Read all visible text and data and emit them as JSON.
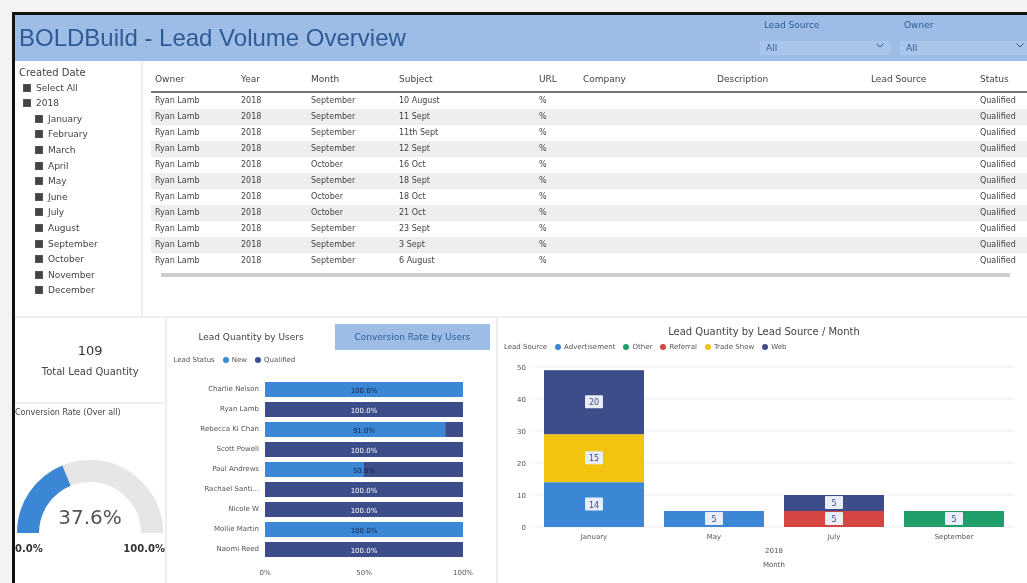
{
  "header": {
    "title": "BOLDBuild - Lead Volume Overview",
    "filters": [
      {
        "label": "Lead Source",
        "value": "All"
      },
      {
        "label": "Owner",
        "value": "All"
      }
    ]
  },
  "date_slicer": {
    "title": "Created Date",
    "items": [
      {
        "label": "Select All",
        "checked": true
      },
      {
        "label": "2018",
        "checked": true,
        "children": [
          {
            "label": "January",
            "checked": true
          },
          {
            "label": "February",
            "checked": true
          },
          {
            "label": "March",
            "checked": true
          },
          {
            "label": "April",
            "checked": true
          },
          {
            "label": "May",
            "checked": true
          },
          {
            "label": "June",
            "checked": true
          },
          {
            "label": "July",
            "checked": true
          },
          {
            "label": "August",
            "checked": true
          },
          {
            "label": "September",
            "checked": true
          },
          {
            "label": "October",
            "checked": true
          },
          {
            "label": "November",
            "checked": true
          },
          {
            "label": "December",
            "checked": true
          }
        ]
      }
    ]
  },
  "table": {
    "columns": [
      "Owner",
      "Year",
      "Month",
      "Subject",
      "URL",
      "Company",
      "Description",
      "Lead Source",
      "Status"
    ],
    "rows": [
      [
        "Ryan Lamb",
        "2018",
        "September",
        "10 August",
        "%",
        "",
        "",
        "",
        "Qualified"
      ],
      [
        "Ryan Lamb",
        "2018",
        "September",
        "11 Sept",
        "%",
        "",
        "",
        "",
        "Qualified"
      ],
      [
        "Ryan Lamb",
        "2018",
        "September",
        "11th Sept",
        "%",
        "",
        "",
        "",
        "Qualified"
      ],
      [
        "Ryan Lamb",
        "2018",
        "September",
        "12 Sept",
        "%",
        "",
        "",
        "",
        "Qualified"
      ],
      [
        "Ryan Lamb",
        "2018",
        "October",
        "16 Oct",
        "%",
        "",
        "",
        "",
        "Qualified"
      ],
      [
        "Ryan Lamb",
        "2018",
        "September",
        "18 Sept",
        "%",
        "",
        "",
        "",
        "Qualified"
      ],
      [
        "Ryan Lamb",
        "2018",
        "October",
        "18 Oct",
        "%",
        "",
        "",
        "",
        "Qualified"
      ],
      [
        "Ryan Lamb",
        "2018",
        "October",
        "21 Oct",
        "%",
        "",
        "",
        "",
        "Qualified"
      ],
      [
        "Ryan Lamb",
        "2018",
        "September",
        "23 Sept",
        "%",
        "",
        "",
        "",
        "Qualified"
      ],
      [
        "Ryan Lamb",
        "2018",
        "September",
        "3 Sept",
        "%",
        "",
        "",
        "",
        "Qualified"
      ],
      [
        "Ryan Lamb",
        "2018",
        "September",
        "6 August",
        "%",
        "",
        "",
        "",
        "Qualified"
      ]
    ]
  },
  "card": {
    "value": "109",
    "label": "Total Lead Quantity"
  },
  "gauge": {
    "title": "Conversion Rate (Over all)",
    "reading": "37.6%",
    "min": "0.0%",
    "max": "100.0%"
  },
  "tabs": [
    {
      "label": "Lead Quantity by Users",
      "selected": false
    },
    {
      "label": "Conversion Rate by Users",
      "selected": true
    }
  ],
  "users_chart": {
    "chart_data": {
      "type": "bar",
      "orientation": "horizontal",
      "stacked": true,
      "legend_title": "Lead Status",
      "xlim": [
        0,
        1
      ],
      "categories": [
        "Charlie Nelson",
        "Ryan Lamb",
        "Rebecca Ki Chan",
        "Scott Powell",
        "Paul Andrews",
        "Rachael Santi...",
        "Nicole W",
        "Mollie Martin",
        "Naomi Reed"
      ],
      "series": [
        {
          "name": "New",
          "color": "#3b87d6",
          "values": [
            1,
            0,
            0.91,
            0,
            0.5,
            0,
            0,
            1,
            0
          ]
        },
        {
          "name": "Qualified",
          "color": "#3c4d8a",
          "values": [
            0,
            1,
            0.09,
            1,
            0.5,
            1,
            1,
            0,
            1
          ]
        }
      ],
      "value_labels": [
        "100.0%",
        "100.0%",
        "91.0%",
        "100.0%",
        "50.0%",
        "100.0%",
        "100.0%",
        "100.0%",
        "100.0%"
      ],
      "xticks": [
        {
          "value": 0,
          "label": "0%"
        },
        {
          "value": 0.5,
          "label": "50%"
        },
        {
          "value": 1,
          "label": "100%"
        }
      ]
    }
  },
  "source_chart": {
    "chart_data": {
      "type": "bar",
      "stacked": true,
      "title": "Lead Quantity by Lead Source / Month",
      "legend_title": "Lead Source",
      "xlabel": "Month",
      "annotations": [
        {
          "text": "2018"
        }
      ],
      "grid": true,
      "categories": [
        "January",
        "May",
        "July",
        "September"
      ],
      "series": [
        {
          "name": "Advertisement",
          "color": "#3b87d6",
          "values": [
            14,
            5,
            null,
            null
          ]
        },
        {
          "name": "Other",
          "color": "#1f9e6a",
          "values": [
            null,
            null,
            null,
            5
          ]
        },
        {
          "name": "Referral",
          "color": "#d64541",
          "values": [
            null,
            null,
            5,
            null
          ]
        },
        {
          "name": "Trade Show",
          "color": "#f2c40f",
          "values": [
            15,
            null,
            null,
            null
          ]
        },
        {
          "name": "Web",
          "color": "#3c4d8a",
          "values": [
            20,
            null,
            5,
            null
          ]
        }
      ],
      "data_labels": true,
      "ylim": [
        0,
        50
      ],
      "yticks": [
        0,
        10,
        20,
        30,
        40,
        50
      ]
    }
  }
}
